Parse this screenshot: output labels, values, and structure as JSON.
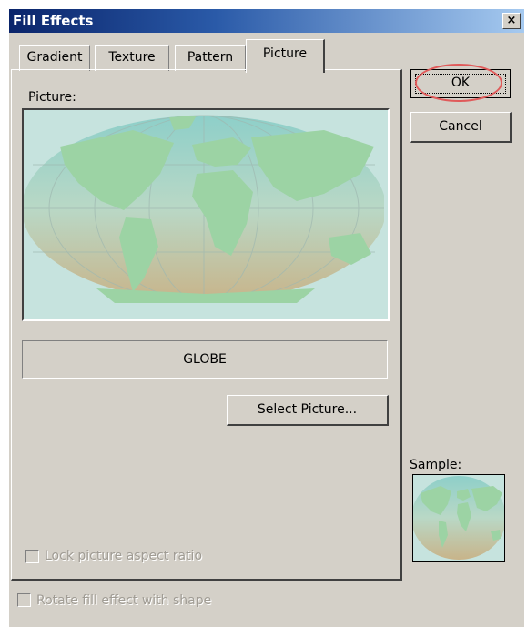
{
  "window": {
    "title": "Fill Effects",
    "close_glyph": "×"
  },
  "tabs": [
    {
      "label": "Gradient",
      "active": false
    },
    {
      "label": "Texture",
      "active": false
    },
    {
      "label": "Pattern",
      "active": false
    },
    {
      "label": "Picture",
      "active": true
    }
  ],
  "picture": {
    "label": "Picture:",
    "name": "GLOBE",
    "select_button": "Select Picture...",
    "lock_aspect_label": "Lock picture aspect ratio",
    "lock_aspect_checked": false
  },
  "buttons": {
    "ok": "OK",
    "cancel": "Cancel"
  },
  "sample": {
    "label": "Sample:"
  },
  "rotate_label": "Rotate fill effect with shape",
  "rotate_checked": false,
  "colors": {
    "face": "#d4d0c8",
    "title_start": "#0a246a",
    "map_ocean": "#c6e3de",
    "map_land": "#9cd3a4",
    "highlight_ring": "#e05a5a"
  },
  "icons": [
    "close-icon",
    "globe-map-picture"
  ]
}
